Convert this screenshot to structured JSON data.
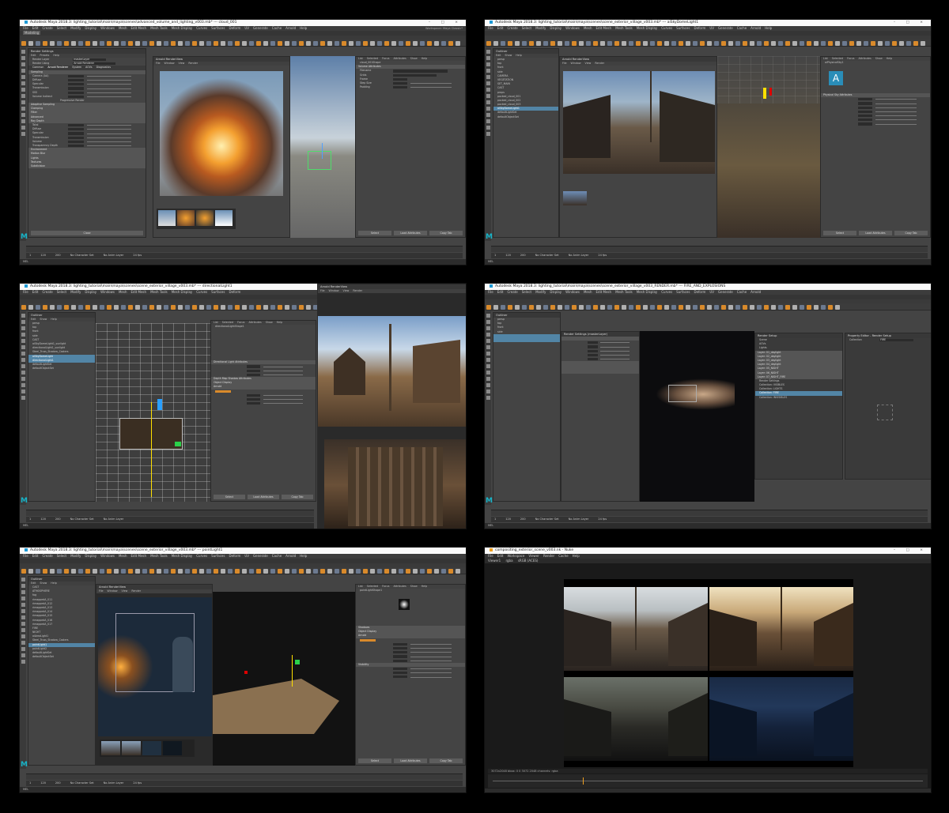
{
  "panels": [
    {
      "title": "Autodesk Maya 2018.3: lighting_tutorial\\main\\maya\\scenes\\advanced_volume_and_lighting_v003.mb* --- cloud_001",
      "menus": [
        "File",
        "Edit",
        "Create",
        "Select",
        "Modify",
        "Display",
        "Windows",
        "Mesh",
        "Edit Mesh",
        "Mesh Tools",
        "Mesh Display",
        "Curves",
        "Surfaces",
        "Deform",
        "UV",
        "Generate",
        "Cache",
        "Arnold",
        "Help"
      ],
      "mode": "Modeling",
      "workspace": "Workspace: Maya Classic*",
      "render_settings": {
        "title": "Render Settings",
        "render_layer": "masterLayer",
        "renderer": "Arnold Renderer",
        "tabs": [
          "Common",
          "Arnold Renderer",
          "System",
          "AOVs",
          "Diagnostics"
        ],
        "rows": [
          "Sampling",
          "Camera (AA)",
          "Diffuse",
          "Specular",
          "Transmission",
          "SSS",
          "Volume Indirect",
          "Progressive Render",
          "Adaptive Sampling",
          "Clamping",
          "Filter",
          "Advanced",
          "Ray Depth",
          "Total",
          "Diffuse",
          "Specular",
          "Transmission",
          "Volume",
          "Transparency Depth",
          "Environment",
          "Motion Blur",
          "Lights",
          "Textures",
          "Subdivision"
        ],
        "close": "Close"
      },
      "renderview_title": "Arnold RenderView",
      "ae_object": "cloud_001Shape",
      "ae_sections": [
        "Volume Attributes",
        "Filename",
        "Grids",
        "Frame",
        "Step Size",
        "Padding"
      ],
      "ae_buttons": [
        "Select",
        "Load Attributes",
        "Copy Tab"
      ]
    },
    {
      "title": "Autodesk Maya 2018.3: lighting_tutorial\\main\\maya\\scenes\\scene_exterior_village_v003.mb* --- aiSkyDomeLight1",
      "menus": [
        "File",
        "Edit",
        "Create",
        "Select",
        "Modify",
        "Display",
        "Windows",
        "Mesh",
        "Edit Mesh",
        "Mesh Tools",
        "Mesh Display",
        "Curves",
        "Surfaces",
        "Deform",
        "UV",
        "Generate",
        "Cache",
        "Arnold",
        "Help"
      ],
      "outliner_title": "Outliner",
      "outliner_rows": [
        "persp",
        "top",
        "front",
        "side",
        "CAMERA",
        "VEGETATION",
        "SET_MAIN",
        "CAST",
        "props",
        "packed_cloud_001",
        "packed_cloud_002",
        "packed_cloud_003",
        "aiSkyDomeLight1",
        "defaultLightSet",
        "defaultObjectSet"
      ],
      "renderview_title": "Arnold RenderView",
      "ae_object": "aiPhysicalSky1",
      "ae_section": "Physical Sky Attributes",
      "ae_buttons": [
        "Select",
        "Load Attributes",
        "Copy Tab"
      ]
    },
    {
      "title": "Autodesk Maya 2018.3: lighting_tutorial\\main\\maya\\scenes\\scene_exterior_village_v003.mb* --- directionalLight1",
      "menus": [
        "File",
        "Edit",
        "Create",
        "Select",
        "Modify",
        "Display",
        "Windows",
        "Mesh",
        "Edit Mesh",
        "Mesh Tools",
        "Mesh Display",
        "Curves",
        "Surfaces",
        "Deform",
        "UV",
        "Generate",
        "Cache",
        "Arnold",
        "Help"
      ],
      "outliner_title": "Outliner",
      "outliner_rows": [
        "persp",
        "top",
        "front",
        "side",
        "CAST",
        "aiSkyDomeLight1_sunlight",
        "directionalLight1_sunlight",
        "Steel_Truss_Shadow_Casters",
        "aiSkyDomeLight",
        "directionalLight1",
        "defaultLightSet",
        "defaultObjectSet"
      ],
      "ae_object": "directionalLightShape1",
      "ae_sections": [
        "Directional Light Attributes",
        "Depth Map Shadow Attributes",
        "Object Display",
        "Arnold"
      ],
      "renderview_title": "Arnold RenderView",
      "ae_buttons": [
        "Select",
        "Load Attributes",
        "Copy Tab"
      ]
    },
    {
      "title": "Autodesk Maya 2018.3: lighting_tutorial\\main\\maya\\scenes\\scene_exterior_village_v003_RENDER.mb* --- FIRE_AND_EXPLOSIONS",
      "menus": [
        "File",
        "Edit",
        "Create",
        "Select",
        "Modify",
        "Display",
        "Windows",
        "Mesh",
        "Edit Mesh",
        "Mesh Tools",
        "Mesh Display",
        "Curves",
        "Surfaces",
        "Deform",
        "UV",
        "Generate",
        "Cache",
        "Arnold",
        "Help"
      ],
      "render_setup_title": "Render Setup",
      "render_setup_rows": [
        "Scene",
        "AOVs",
        "Lights",
        "Layer: 01_daylight",
        "Layer: 02_daylight",
        "Layer: 03_daylight",
        "Layer: 04_daylight",
        "Layer: 05_NIGHT",
        "Layer: 06_NIGHT",
        "Layer: 07_NIGHT_FIRE",
        "Render Settings",
        "Collection: VISIBLES",
        "Collection: LIGHTS",
        "Collection: FIRE",
        "Collection: INVISIBLES"
      ],
      "property_editor_title": "Property Editor - Render Setup",
      "collection_label": "Collection",
      "collection_value": "FIRE",
      "render_settings_title": "Render Settings (masterLayer)",
      "ae_buttons": [
        "Select",
        "Load Attributes",
        "Copy Tab"
      ]
    },
    {
      "title": "Autodesk Maya 2018.3: lighting_tutorial\\main\\maya\\scenes\\scene_exterior_village_v003.mb* --- pointLight1",
      "menus": [
        "File",
        "Edit",
        "Create",
        "Select",
        "Modify",
        "Display",
        "Windows",
        "Mesh",
        "Edit Mesh",
        "Mesh Tools",
        "Mesh Display",
        "Curves",
        "Surfaces",
        "Deform",
        "UV",
        "Generate",
        "Cache",
        "Arnold",
        "Help"
      ],
      "outliner_title": "Outliner",
      "outliner_rows": [
        "CAST",
        "ATMOSPHERE",
        "fog",
        "rimappedA_011",
        "rimappedA_012",
        "rimappedA_013",
        "rimappedA_014",
        "rimappedA_015",
        "rimappedA_016",
        "rimappedA_017",
        "FIRE",
        "NIGHT",
        "aiAreaLight1",
        "Steel_Truss_Shadow_Casters",
        "pointLight1",
        "pointLight2",
        "defaultLightSet",
        "defaultObjectSet"
      ],
      "ae_object": "pointLightShape1",
      "ae_sections": [
        "Shadows",
        "Object Display",
        "Arnold",
        "Visibility"
      ],
      "renderview_title": "Arnold RenderView",
      "ae_buttons": [
        "Select",
        "Load Attributes",
        "Copy Tab"
      ]
    },
    {
      "title": "compositing_exterior_scene_v003.nk - Nuke",
      "menus": [
        "File",
        "Edit",
        "Workspace",
        "Viewer",
        "Render",
        "Cache",
        "Help"
      ],
      "viewer_tab": "Viewer1",
      "channels": "rgba",
      "colorspace": "sRGB (ACES)",
      "status": "3072x2048  bbox: 0 0 3072 2048  channels: rgba"
    }
  ],
  "common": {
    "range_start": "1",
    "range_end": "120",
    "range_max": "200",
    "character_set": "No Character Set",
    "anim_layer": "No Anim Layer",
    "fps": "24 fps",
    "mel": "MEL"
  },
  "colors": {
    "maya_bg": "#444444",
    "selection": "#5285a6",
    "arnold_orange": "#d98a2b",
    "maya_logo": "#18b4c8"
  }
}
